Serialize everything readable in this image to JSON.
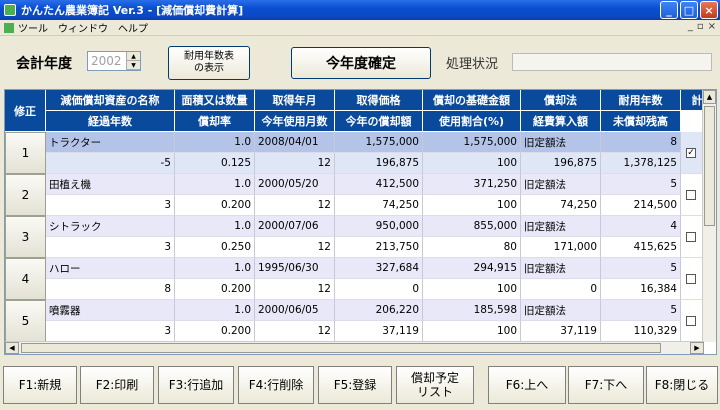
{
  "window": {
    "title": "かんたん農業簿記 Ver.3 - [減価償却費計算]",
    "min": "_",
    "max": "□",
    "close": "×"
  },
  "menu": {
    "items": [
      "ツール",
      "ウィンドウ",
      "ヘルプ"
    ],
    "mdi_controls": [
      "_",
      "▫",
      "×"
    ]
  },
  "toolbar": {
    "year_label": "会計年度",
    "year_value": "2002",
    "life_table_btn": "耐用年数表\nの表示",
    "confirm_btn": "今年度確定",
    "status_label": "処理状況",
    "status_value": ""
  },
  "grid": {
    "corner": "修正",
    "headers_top": [
      "減価償却資産の名称",
      "面積又は数量",
      "取得年月",
      "取得価格",
      "償却の基礎金額",
      "償却法",
      "耐用年数",
      "計算"
    ],
    "headers_bottom": [
      "経過年数",
      "償却率",
      "今年使用月数",
      "今年の償却額",
      "使用割合(%)",
      "経費算入額",
      "未償却残高"
    ],
    "rows": [
      {
        "no": "1",
        "name": "トラクター",
        "qty": "1.0",
        "date": "2008/04/01",
        "price": "1,575,000",
        "base": "1,575,000",
        "method": "旧定額法",
        "life": "8",
        "elapsed": "-5",
        "rate": "0.125",
        "months": "12",
        "depr": "196,875",
        "ratio": "100",
        "expense": "196,875",
        "remain": "1,378,125",
        "checked": "✓"
      },
      {
        "no": "2",
        "name": "田植え機",
        "qty": "1.0",
        "date": "2000/05/20",
        "price": "412,500",
        "base": "371,250",
        "method": "旧定額法",
        "life": "5",
        "elapsed": "3",
        "rate": "0.200",
        "months": "12",
        "depr": "74,250",
        "ratio": "100",
        "expense": "74,250",
        "remain": "214,500",
        "checked": ""
      },
      {
        "no": "3",
        "name": "シトラック",
        "qty": "1.0",
        "date": "2000/07/06",
        "price": "950,000",
        "base": "855,000",
        "method": "旧定額法",
        "life": "4",
        "elapsed": "3",
        "rate": "0.250",
        "months": "12",
        "depr": "213,750",
        "ratio": "80",
        "expense": "171,000",
        "remain": "415,625",
        "checked": ""
      },
      {
        "no": "4",
        "name": "ハロー",
        "qty": "1.0",
        "date": "1995/06/30",
        "price": "327,684",
        "base": "294,915",
        "method": "旧定額法",
        "life": "5",
        "elapsed": "8",
        "rate": "0.200",
        "months": "12",
        "depr": "0",
        "ratio": "100",
        "expense": "0",
        "remain": "16,384",
        "checked": ""
      },
      {
        "no": "5",
        "name": "噴霧器",
        "qty": "1.0",
        "date": "2000/06/05",
        "price": "206,220",
        "base": "185,598",
        "method": "旧定額法",
        "life": "5",
        "elapsed": "3",
        "rate": "0.200",
        "months": "12",
        "depr": "37,119",
        "ratio": "100",
        "expense": "37,119",
        "remain": "110,329",
        "checked": ""
      }
    ]
  },
  "fkeys": [
    "F1:新規",
    "F2:印刷",
    "F3:行追加",
    "F4:行削除",
    "F5:登録",
    "償却予定\nリスト",
    "F6:上へ",
    "F7:下へ",
    "F8:閉じる"
  ],
  "colors": {
    "header": "#0a4a9c",
    "row_odd": "#e8e8f8",
    "row_even": "#ffffff",
    "row_selected": "#b4c4e8"
  }
}
